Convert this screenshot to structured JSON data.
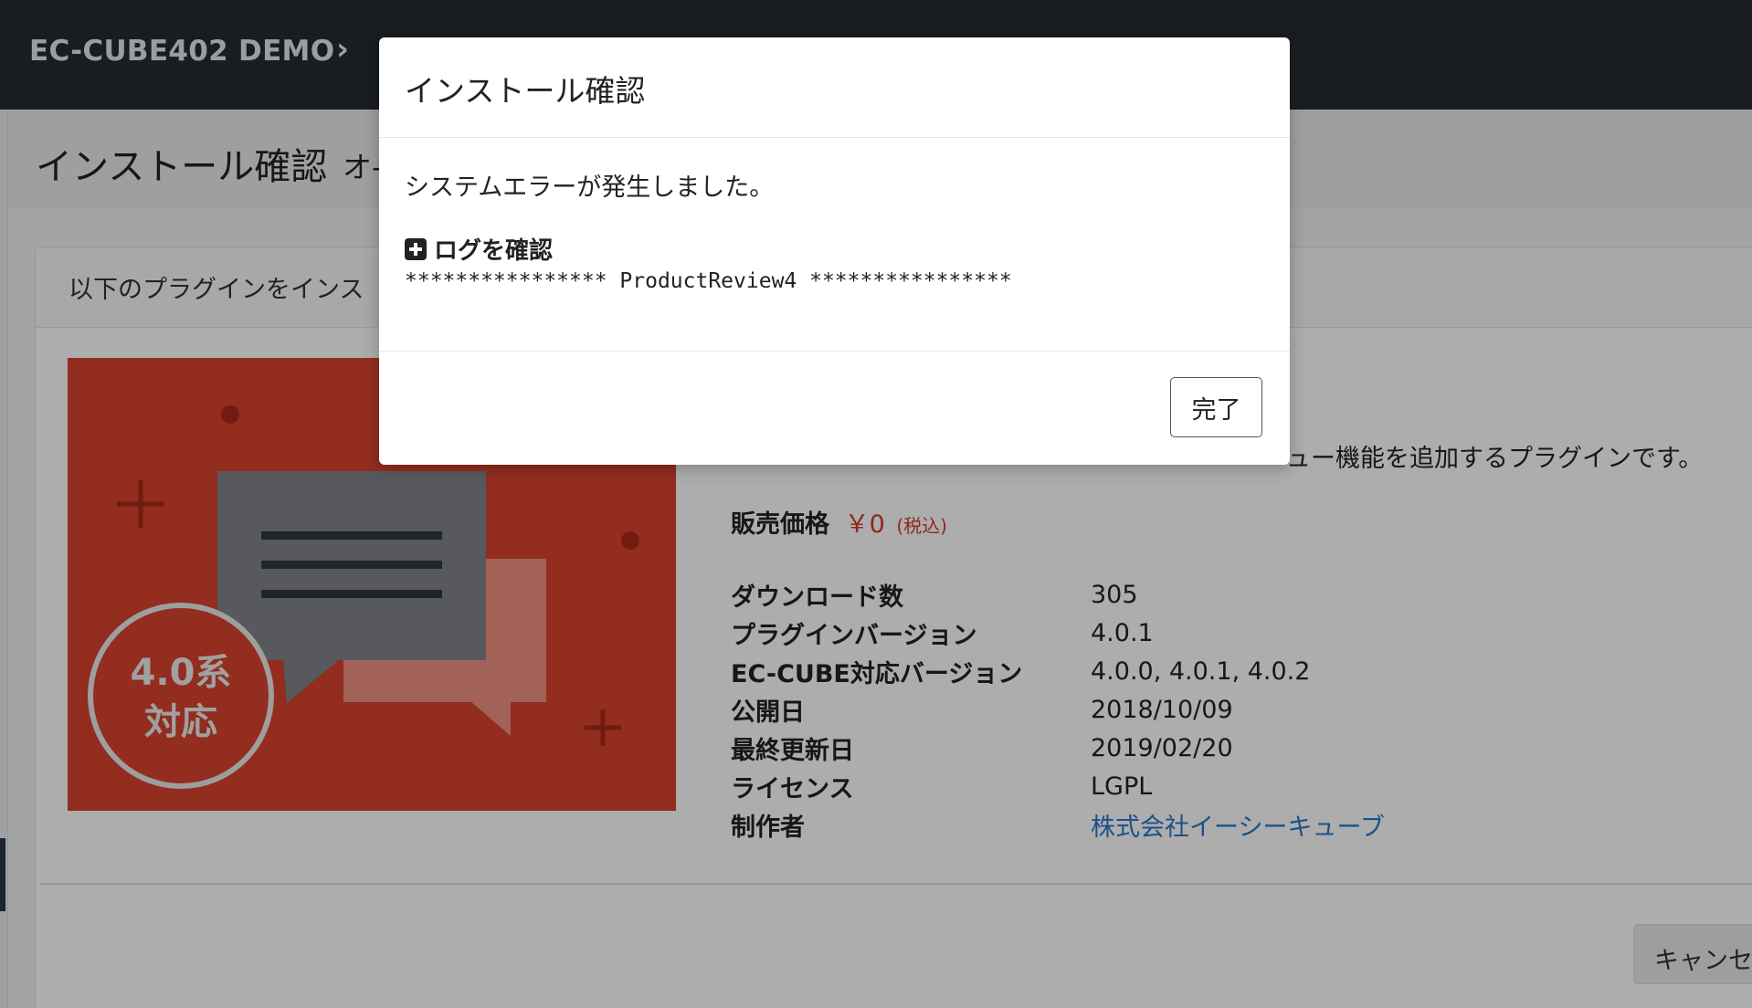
{
  "header": {
    "shop_name": "EC-CUBE402 DEMO",
    "chevron": "›"
  },
  "page": {
    "title": "インストール確認",
    "subtitle_fragment": "オ-"
  },
  "card": {
    "heading_fragment": "以下のプラグインをインス",
    "description_fragment": "ュー機能を追加するプラグインです。",
    "image_badge": [
      "4.0系",
      "対応"
    ],
    "price": {
      "label": "販売価格",
      "value": "￥0",
      "tax": "(税込)"
    },
    "specs": [
      {
        "label": "ダウンロード数",
        "value": "305"
      },
      {
        "label": "プラグインバージョン",
        "value": "4.0.1"
      },
      {
        "label": "EC-CUBE対応バージョン",
        "value": "4.0.0, 4.0.1, 4.0.2"
      },
      {
        "label": "公開日",
        "value": "2018/10/09"
      },
      {
        "label": "最終更新日",
        "value": "2019/02/20"
      },
      {
        "label": "ライセンス",
        "value": "LGPL"
      },
      {
        "label": "制作者",
        "value": "株式会社イーシーキューブ"
      }
    ],
    "cancel_label": "キャンセ"
  },
  "modal": {
    "title": "インストール確認",
    "message": "システムエラーが発生しました。",
    "log_toggle_label": "ログを確認",
    "log_text": "**************** ProductReview4 ****************",
    "done_label": "完了"
  },
  "colors": {
    "header_bg": "#252b33",
    "image_bg": "#d8432f",
    "price": "#d33a2c",
    "link": "#2a78c8"
  }
}
